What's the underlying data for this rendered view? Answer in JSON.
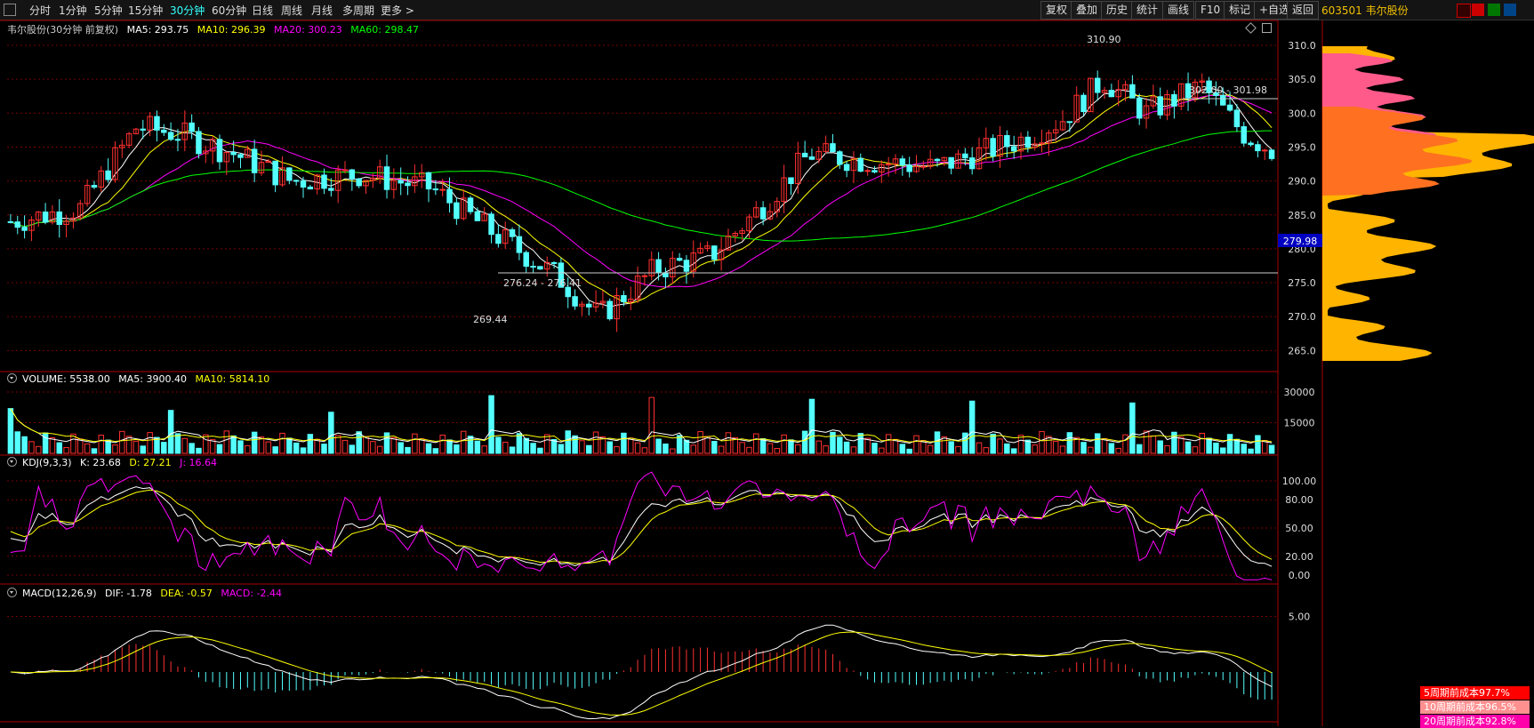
{
  "toolbar": {
    "periods": [
      "分时",
      "1分钟",
      "5分钟",
      "15分钟",
      "30分钟",
      "60分钟",
      "日线",
      "周线",
      "月线",
      "多周期",
      "更多 >"
    ],
    "active_period": "30分钟",
    "right_buttons": [
      "复权",
      "叠加",
      "历史",
      "统计",
      "画线",
      "F10",
      "标记",
      "+自选",
      "返回"
    ],
    "stock_code_name": "603501 韦尔股份"
  },
  "price_panel": {
    "title": "韦尔股份(30分钟 前复权)",
    "ma5": "MA5: 293.75",
    "ma10": "MA10: 296.39",
    "ma20": "MA20: 300.23",
    "ma60": "MA60: 298.47",
    "high_label": "310.90",
    "low_label": "269.44",
    "range_label_1": "302.00 - 301.98",
    "range_label_2": "276.24 - 276.41",
    "current_price": "279.98",
    "y_ticks": [
      "310.0",
      "305.0",
      "300.0",
      "295.0",
      "290.0",
      "285.0",
      "280.0",
      "275.0",
      "270.0",
      "265.0"
    ]
  },
  "volume_panel": {
    "title": "VOLUME: 5538.00",
    "ma5": "MA5: 3900.40",
    "ma10": "MA10: 5814.10",
    "y_ticks": [
      "30000",
      "15000"
    ]
  },
  "kdj_panel": {
    "title": "KDJ(9,3,3)",
    "k": "K: 23.68",
    "d": "D: 27.21",
    "j": "J: 16.64",
    "y_ticks": [
      "100.00",
      "80.00",
      "50.00",
      "20.00",
      "0.00"
    ]
  },
  "macd_panel": {
    "title": "MACD(12,26,9)",
    "dif": "DIF: -1.78",
    "dea": "DEA: -0.57",
    "macd": "MACD: -2.44",
    "y_ticks": [
      "5.00"
    ]
  },
  "cost_distribution": [
    {
      "label": "5周期前成本97.7%",
      "color": "#ff0000"
    },
    {
      "label": "10周期前成本96.5%",
      "color": "#ff9090"
    },
    {
      "label": "20周期前成本92.8%",
      "color": "#ff00aa"
    }
  ],
  "colors": {
    "up": "#ff3030",
    "down": "#54ffff",
    "ma5": "#ffffff",
    "ma10": "#ffff00",
    "ma20": "#ff00ff",
    "ma60": "#00ff00"
  }
}
